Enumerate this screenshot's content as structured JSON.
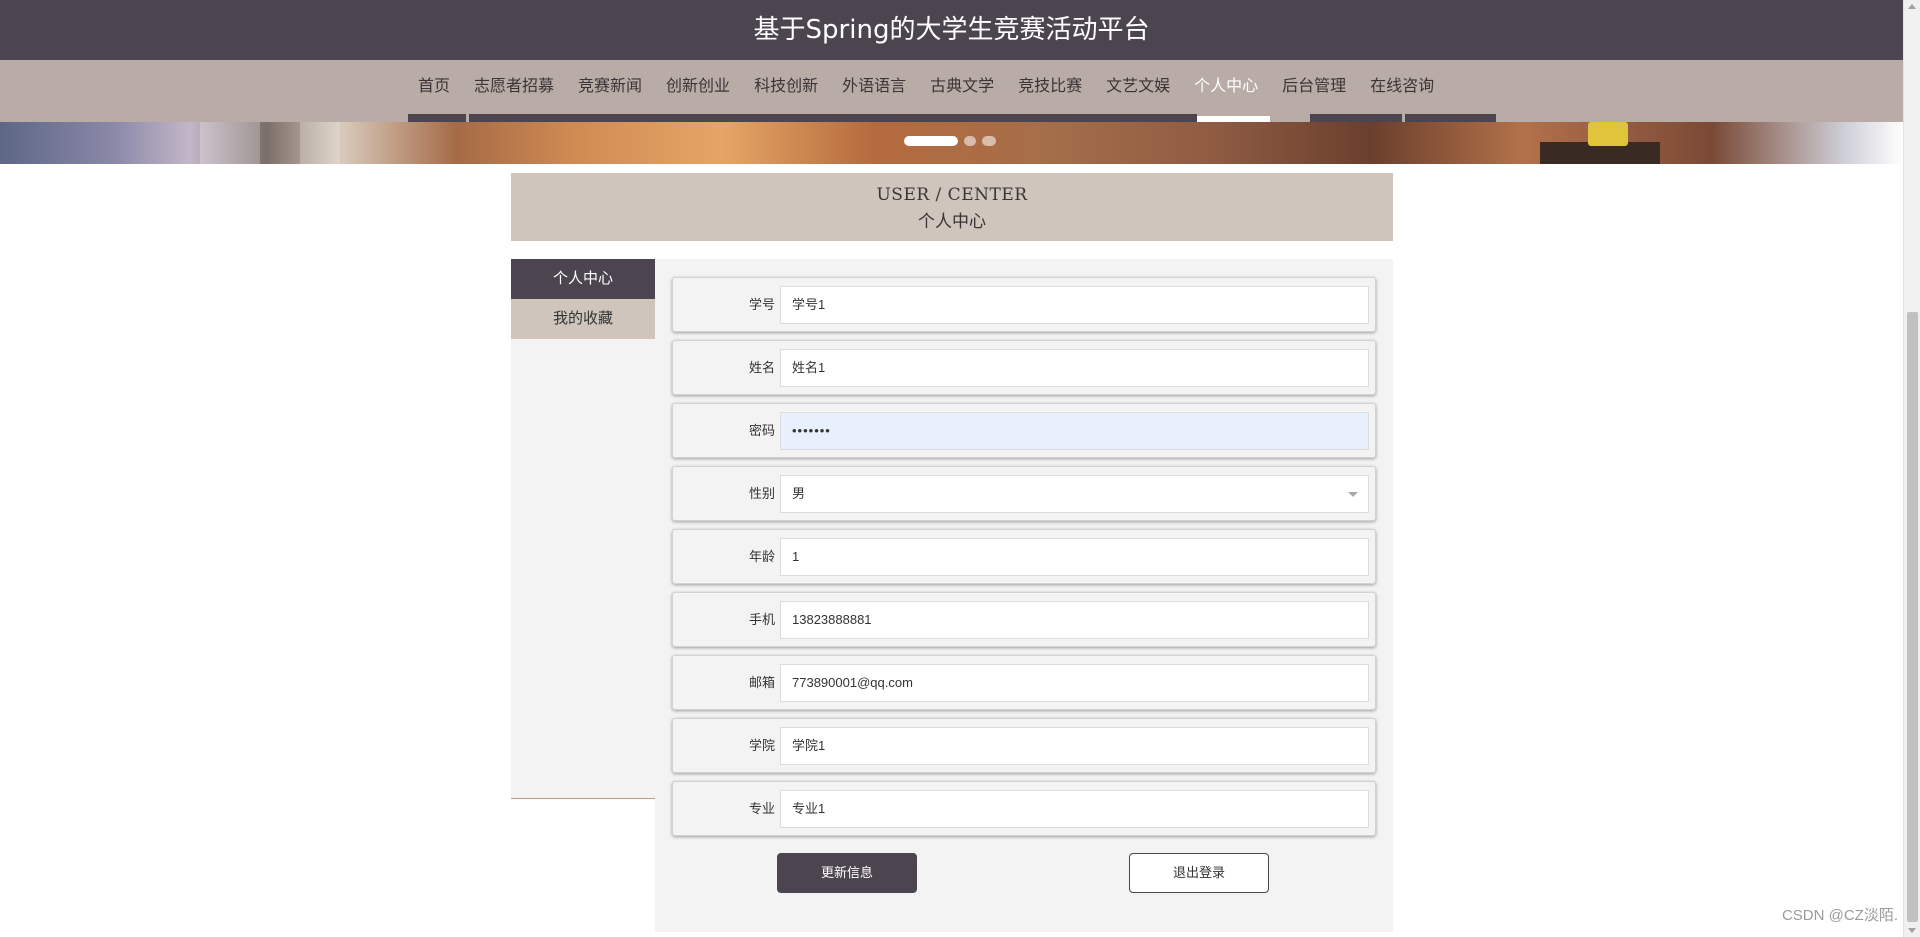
{
  "header": {
    "title": "基于Spring的大学生竞赛活动平台"
  },
  "nav": {
    "items": [
      "首页",
      "志愿者招募",
      "竞赛新闻",
      "创新创业",
      "科技创新",
      "外语语言",
      "古典文学",
      "竞技比赛",
      "文艺文娱",
      "个人中心",
      "后台管理",
      "在线咨询"
    ],
    "active": "个人中心"
  },
  "section": {
    "title_en": "USER / CENTER",
    "title_cn": "个人中心"
  },
  "sidebar": {
    "items": [
      "个人中心",
      "我的收藏"
    ]
  },
  "form": {
    "student_id": {
      "label": "学号",
      "value": "学号1"
    },
    "name": {
      "label": "姓名",
      "value": "姓名1"
    },
    "password": {
      "label": "密码",
      "value": "•••••••"
    },
    "gender": {
      "label": "性别",
      "value": "男"
    },
    "age": {
      "label": "年龄",
      "value": "1"
    },
    "phone": {
      "label": "手机",
      "value": "13823888881"
    },
    "email": {
      "label": "邮箱",
      "value": "773890001@qq.com"
    },
    "college": {
      "label": "学院",
      "value": "学院1"
    },
    "major": {
      "label": "专业",
      "value": "专业1"
    }
  },
  "buttons": {
    "update": "更新信息",
    "logout": "退出登录"
  },
  "watermark": "CSDN @CZ淡陌.",
  "colors": {
    "header_bg": "#4c4550",
    "nav_bg": "#b9aca6",
    "section_bg": "#cfc5bd",
    "panel_bg": "#f3f3f3"
  }
}
